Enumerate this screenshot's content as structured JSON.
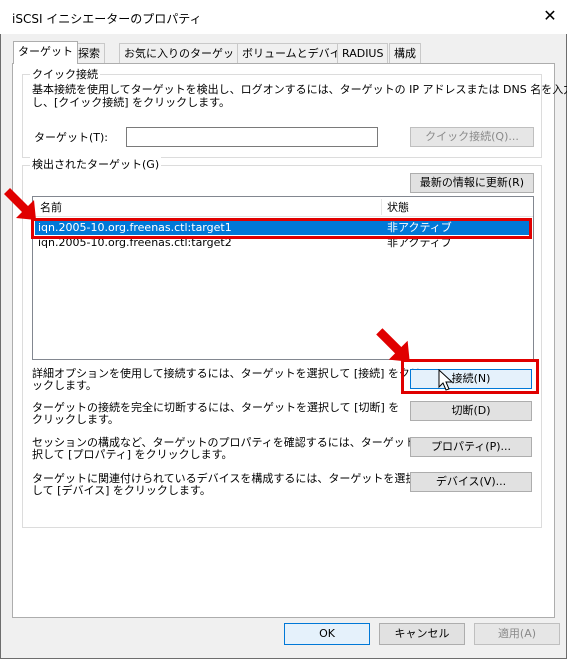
{
  "window": {
    "title": "iSCSI イニシエーターのプロパティ",
    "close_glyph": "✕"
  },
  "tabs": [
    {
      "label": "ターゲット"
    },
    {
      "label": "探索"
    },
    {
      "label": "お気に入りのターゲット"
    },
    {
      "label": "ボリュームとデバイス"
    },
    {
      "label": "RADIUS"
    },
    {
      "label": "構成"
    }
  ],
  "quick_connect": {
    "group_label": "クイック接続",
    "description_line1": "基本接続を使用してターゲットを検出し、ログオンするには、ターゲットの IP アドレスまたは DNS 名を入力",
    "description_line2": "し、[クイック接続] をクリックします。",
    "target_label": "ターゲット(T):",
    "target_value": "",
    "button_label": "クイック接続(Q)..."
  },
  "discovered": {
    "group_label": "検出されたターゲット(G)",
    "refresh_label": "最新の情報に更新(R)",
    "columns": {
      "name": "名前",
      "status": "状態"
    },
    "rows": [
      {
        "name": "iqn.2005-10.org.freenas.ctl:target1",
        "status": "非アクティブ"
      },
      {
        "name": "iqn.2005-10.org.freenas.ctl:target2",
        "status": "非アクティブ"
      }
    ],
    "selected_index": 0
  },
  "actions": [
    {
      "line1": "詳細オプションを使用して接続するには、ターゲットを選択して [接続] をクリ",
      "line2": "ックします。",
      "button": "接続(N)"
    },
    {
      "line1": "ターゲットの接続を完全に切断するには、ターゲットを選択して [切断] を",
      "line2": "クリックします。",
      "button": "切断(D)"
    },
    {
      "line1": "セッションの構成など、ターゲットのプロパティを確認するには、ターゲットを選",
      "line2": "択して [プロパティ] をクリックします。",
      "button": "プロパティ(P)..."
    },
    {
      "line1": "ターゲットに関連付けられているデバイスを構成するには、ターゲットを選択",
      "line2": "して [デバイス] をクリックします。",
      "button": "デバイス(V)..."
    }
  ],
  "footer": {
    "ok": "OK",
    "cancel": "キャンセル",
    "apply": "適用(A)"
  },
  "colors": {
    "highlight": "#e00000",
    "selection": "#0078d7"
  }
}
